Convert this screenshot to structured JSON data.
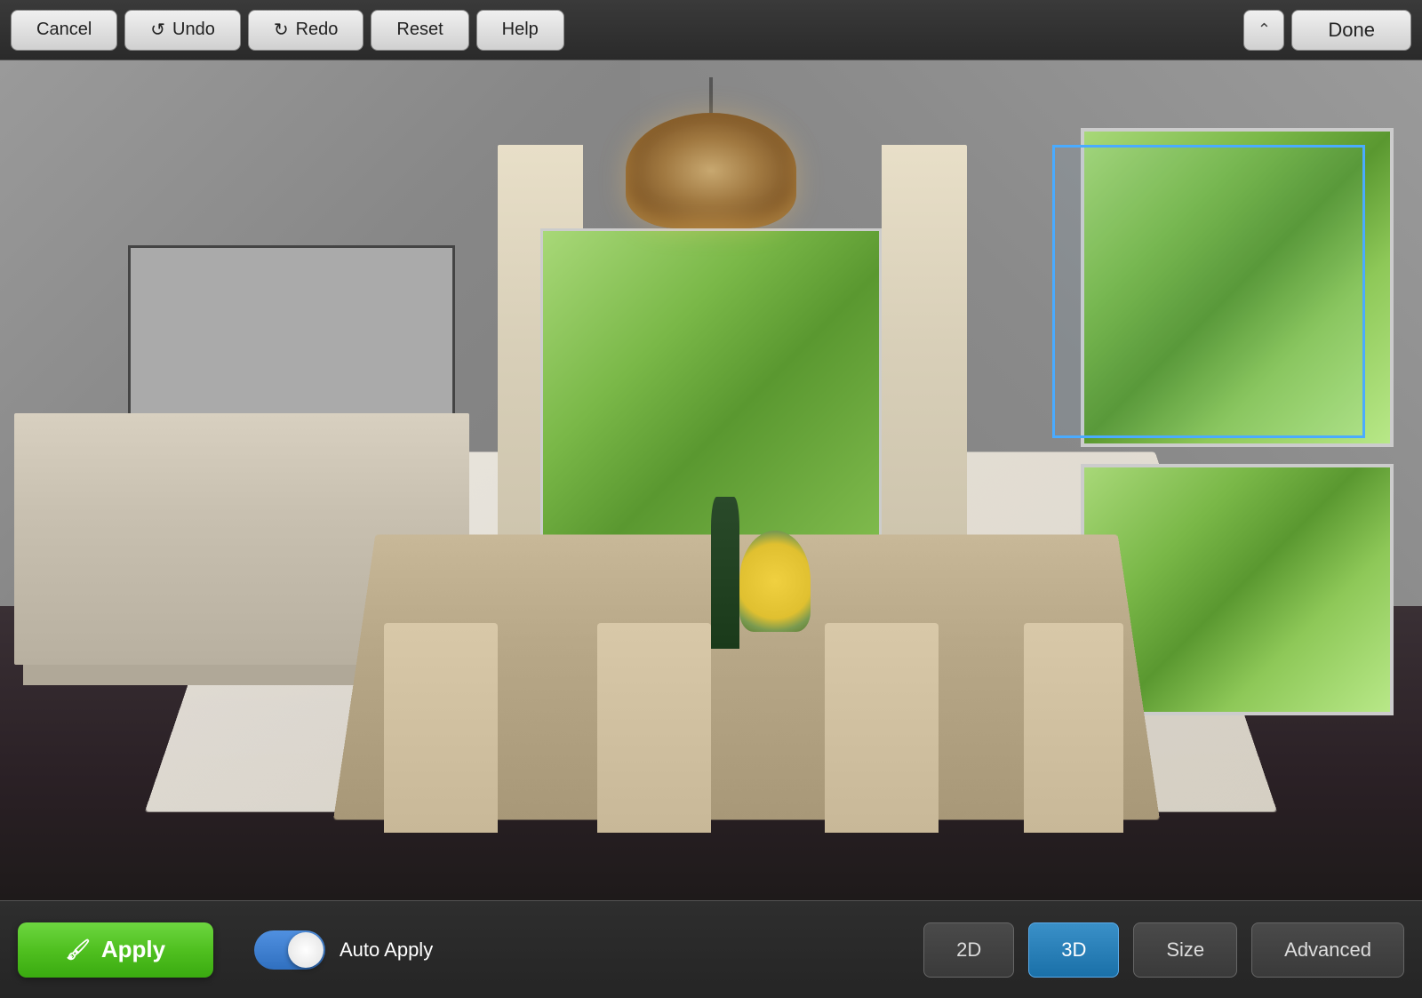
{
  "toolbar": {
    "cancel_label": "Cancel",
    "undo_label": "Undo",
    "redo_label": "Redo",
    "reset_label": "Reset",
    "help_label": "Help",
    "done_label": "Done"
  },
  "bottom": {
    "apply_label": "Apply",
    "auto_apply_label": "Auto Apply",
    "mode_2d_label": "2D",
    "mode_3d_label": "3D",
    "size_label": "Size",
    "advanced_label": "Advanced"
  },
  "scene": {
    "description": "Dining room 3D visualization"
  }
}
